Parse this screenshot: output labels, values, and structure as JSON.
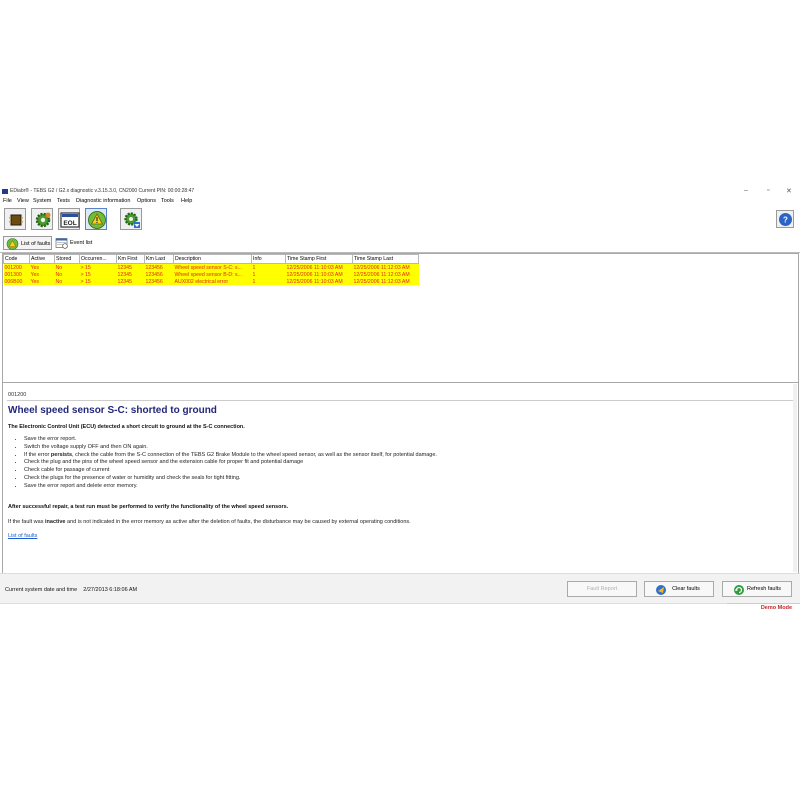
{
  "app": {
    "title": "EDiabr® - TEBS G2 / G2.x diagnostic v.3.15.3.0, CN2000 Current PIN: 00:00:28:47"
  },
  "window_controls": {
    "minimize": "–",
    "maximize": "▫",
    "close": "✕"
  },
  "menu": [
    "File",
    "View",
    "System",
    "Tests",
    "Diagnostic information",
    "Options",
    "Tools",
    "Help"
  ],
  "toolbar": {
    "buttons": [
      "ecu-module-icon",
      "gear-settings-icon",
      "eol-icon",
      "warning-triangle-icon",
      "gear-download-icon"
    ],
    "eol_label": "EOL",
    "help": "?"
  },
  "tabs": [
    {
      "label": "List of faults",
      "active": true
    },
    {
      "label": "Event list",
      "active": false
    }
  ],
  "faults_table": {
    "columns": [
      "Code",
      "Active",
      "Stored",
      "Occurren...",
      "Km First",
      "Km Last",
      "Description",
      "Info",
      "Time Stamp First",
      "Time Stamp Last"
    ],
    "rows": [
      [
        "001200",
        "Yes",
        "No",
        "> 15",
        "12345",
        "123456",
        "Wheel speed sensor S-C: s...",
        "1",
        "12/25/2006 11:10:03 AM",
        "12/25/2006 11:12:03 AM"
      ],
      [
        "001300",
        "Yes",
        "No",
        "> 15",
        "12345",
        "123456",
        "Wheel speed sensor B-D: s...",
        "1",
        "12/25/2006 11:10:03 AM",
        "12/25/2006 11:12:03 AM"
      ],
      [
        "006B00",
        "Yes",
        "No",
        "> 15",
        "12345",
        "123456",
        "AUX002 electrical error",
        "1",
        "12/25/2006 11:10:03 AM",
        "12/25/2006 11:12:03 AM"
      ]
    ],
    "row_color": "#ffff00",
    "text_color": "#e0261c"
  },
  "details": {
    "code": "001200",
    "heading": "Wheel speed sensor S-C: shorted to ground",
    "intro": "The Electronic Control Unit (ECU) detected a short circuit to ground at the S-C connection.",
    "steps": [
      {
        "pre": "Save the error report.",
        "bold": "",
        "post": ""
      },
      {
        "pre": "Switch the voltage supply OFF and then ON again.",
        "bold": "",
        "post": ""
      },
      {
        "pre": "If the error ",
        "bold": "persists",
        "post": ", check the cable from the S-C connection of the TEBS G2 Brake Module to the wheel speed sensor, as well as the sensor itself, for potential damage."
      },
      {
        "pre": "Check the plug and the pins of the wheel speed sensor and the extension cable for proper fit and potential damage",
        "bold": "",
        "post": ""
      },
      {
        "pre": "Check cable for passage of current",
        "bold": "",
        "post": ""
      },
      {
        "pre": "Check the plugs for the presence of water or humidity and check the seals for tight fitting.",
        "bold": "",
        "post": ""
      },
      {
        "pre": "Save the error report and delete error memory.",
        "bold": "",
        "post": ""
      }
    ],
    "repair_note": "After successful repair, a test run must be performed to verify the functionality of the wheel speed sensors.",
    "note_pre": "If the fault was ",
    "note_bold": "inactive",
    "note_post": " and is not indicated in the error memory as active after the deletion of faults, the disturbance may be caused by external operating conditions.",
    "link": "List of faults"
  },
  "status": {
    "date_label": "Current system date and time",
    "date_value": "2/27/2013 6:18:06 AM",
    "buttons": {
      "fault_report": "Fault Report",
      "clear_faults": "Clear faults",
      "refresh_faults": "Refresh faults"
    },
    "demo_mode": "Demo Mode"
  }
}
